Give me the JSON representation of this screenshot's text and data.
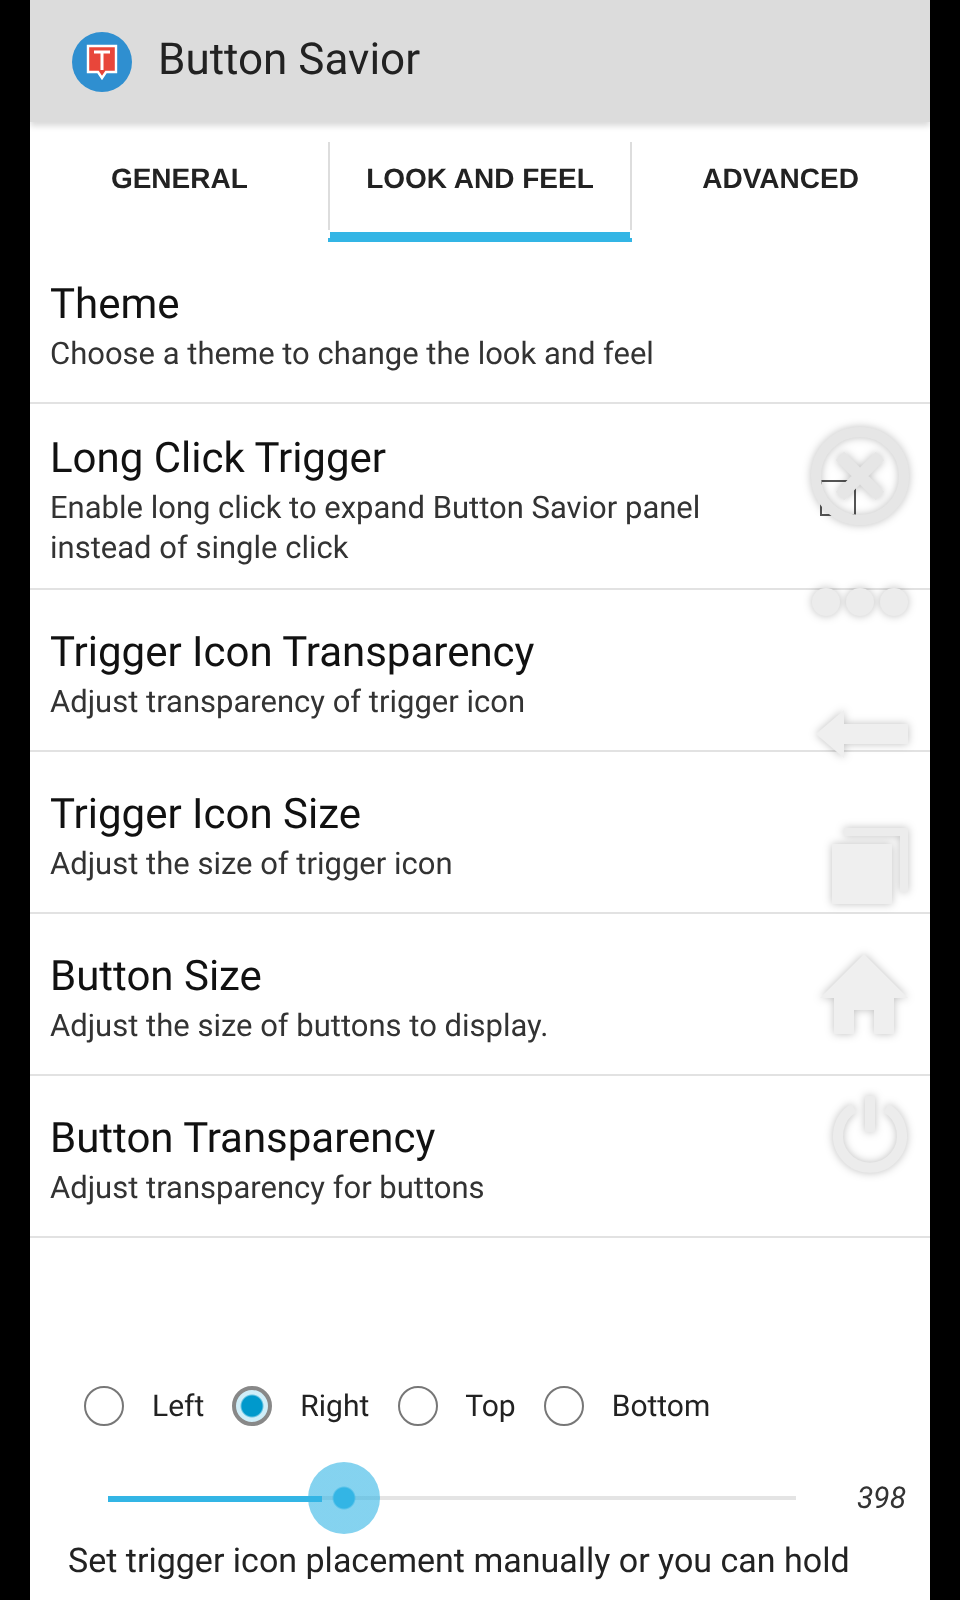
{
  "app_bar": {
    "title": "Button Savior"
  },
  "tabs": [
    {
      "label": "GENERAL",
      "selected": false
    },
    {
      "label": "LOOK AND FEEL",
      "selected": true
    },
    {
      "label": "ADVANCED",
      "selected": false
    }
  ],
  "settings": [
    {
      "kind": "plain",
      "title": "Theme",
      "summary": "Choose a theme to change the look and feel"
    },
    {
      "kind": "checkbox",
      "title": "Long Click Trigger",
      "summary": "Enable long click to expand Button Savior panel instead of single click",
      "checked": false
    },
    {
      "kind": "plain",
      "title": "Trigger Icon Transparency",
      "summary": "Adjust transparency of trigger icon"
    },
    {
      "kind": "plain",
      "title": "Trigger Icon Size",
      "summary": "Adjust the size of trigger icon"
    },
    {
      "kind": "plain",
      "title": "Button Size",
      "summary": "Adjust the size of buttons to display."
    },
    {
      "kind": "plain",
      "title": "Button Transparency",
      "summary": "Adjust transparency for buttons"
    }
  ],
  "placement": {
    "options": [
      {
        "label": "Left",
        "selected": false
      },
      {
        "label": "Right",
        "selected": true
      },
      {
        "label": "Top",
        "selected": false
      },
      {
        "label": "Bottom",
        "selected": false
      }
    ],
    "slider": {
      "level": 0.31,
      "reading": "398"
    },
    "hint": "Set trigger icon placement manually or you can hold"
  }
}
